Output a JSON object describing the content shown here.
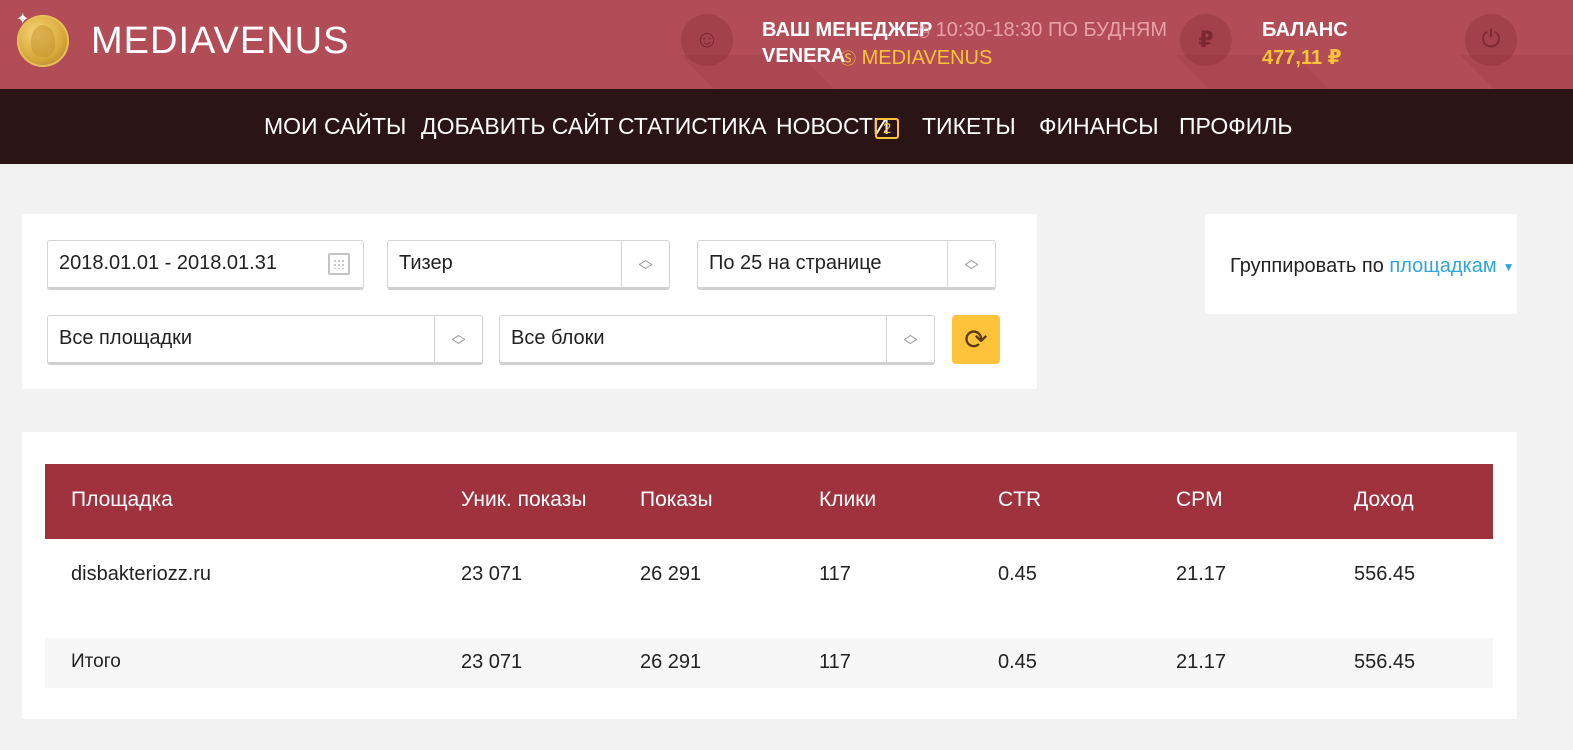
{
  "brand": {
    "name": "MEDIAVENUS"
  },
  "manager": {
    "title": "ВАШ МЕНЕДЖЕР",
    "hours": "10:30-18:30 ПО БУДНЯМ",
    "name": "VENERA",
    "skype": "MEDIAVENUS"
  },
  "balance": {
    "title": "БАЛАНС",
    "value": "477,11 ₽"
  },
  "nav": {
    "items": [
      "МОИ САЙТЫ",
      "ДОБАВИТЬ САЙТ",
      "СТАТИСТИКА",
      "НОВОСТИ",
      "ТИКЕТЫ",
      "ФИНАНСЫ",
      "ПРОФИЛЬ"
    ],
    "news_badge": "2"
  },
  "filters": {
    "date_range": "2018.01.01 - 2018.01.31",
    "ad_type": "Тизер",
    "per_page": "По 25 на странице",
    "sites": "Все площадки",
    "blocks": "Все блоки"
  },
  "grouping": {
    "label": "Группировать по",
    "value": "площадкам"
  },
  "table": {
    "headers": [
      "Площадка",
      "Уник. показы",
      "Показы",
      "Клики",
      "CTR",
      "CPM",
      "Доход"
    ],
    "rows": [
      [
        "disbakteriozz.ru",
        "23 071",
        "26 291",
        "117",
        "0.45",
        "21.17",
        "556.45"
      ]
    ],
    "total": [
      "Итого",
      "23 071",
      "26 291",
      "117",
      "0.45",
      "21.17",
      "556.45"
    ]
  },
  "colors": {
    "header_bg": "#b24d57",
    "nav_bg": "#2b1415",
    "accent_yellow": "#fec33a",
    "table_header_bg": "#a0323e",
    "link_blue": "#2ea6dd"
  },
  "icons": {
    "logo": "venus-coin-icon",
    "manager": "manager-avatar-icon",
    "clock": "clock-icon",
    "skype": "skype-icon",
    "balance": "ruble-icon",
    "logout": "power-icon",
    "calendar": "calendar-icon",
    "refresh": "refresh-icon"
  }
}
